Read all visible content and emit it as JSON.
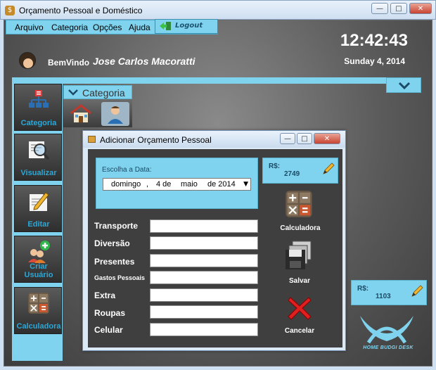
{
  "window": {
    "title": "Orçamento Pessoal e Doméstico",
    "controls": {
      "minimize": "—",
      "maximize": "□",
      "close": "✕"
    }
  },
  "menu": {
    "items": [
      "Arquivo",
      "Categoria",
      "Opções",
      "Ajuda"
    ],
    "logout_label": "Logout"
  },
  "header": {
    "welcome": "BemVindo",
    "username": "Jose Carlos Macoratti",
    "time": "12:42:43",
    "date": "Sunday 4, 2014"
  },
  "sidebar": {
    "items": [
      {
        "label": "Categoria",
        "icon": "hierarchy-icon"
      },
      {
        "label": "Visualizar",
        "icon": "magnifier-icon"
      },
      {
        "label": "Editar",
        "icon": "pencil-paper-icon"
      },
      {
        "label": "Criar Usuário",
        "icon": "add-user-icon"
      },
      {
        "label": "Calculadora",
        "icon": "calculator-icon"
      }
    ]
  },
  "categoria_panel": {
    "title": "Categoria",
    "icons": [
      "home-icon",
      "user-icon"
    ]
  },
  "dialog": {
    "title": "Adicionar Orçamento Pessoal",
    "controls": {
      "minimize": "—",
      "maximize": "□",
      "close": "✕"
    },
    "date_caption": "Escolha a Data:",
    "date": {
      "weekday": "domingo",
      "sep": ",",
      "day": "4 de",
      "month": "maio",
      "year": "de 2014"
    },
    "fields": [
      {
        "label": "Transporte",
        "value": ""
      },
      {
        "label": "Diversão",
        "value": ""
      },
      {
        "label": "Presentes",
        "value": ""
      },
      {
        "label": "Gastos Pessoais",
        "value": ""
      },
      {
        "label": "Extra",
        "value": ""
      },
      {
        "label": "Roupas",
        "value": ""
      },
      {
        "label": "Celular",
        "value": ""
      }
    ],
    "amount": {
      "currency": "R$:",
      "value": "2749"
    },
    "actions": [
      {
        "label": "Calculadora",
        "icon": "calculator-icon"
      },
      {
        "label": "Salvar",
        "icon": "floppy-disk-icon"
      },
      {
        "label": "Cancelar",
        "icon": "red-x-icon"
      }
    ]
  },
  "total_box": {
    "currency": "R$:",
    "value": "1103"
  },
  "logo": {
    "text": "HOME BUDGI DESK"
  },
  "colors": {
    "accent": "#7fd3ee",
    "sidebar_label": "#2aa8d8",
    "background": "#4a4a4a"
  }
}
